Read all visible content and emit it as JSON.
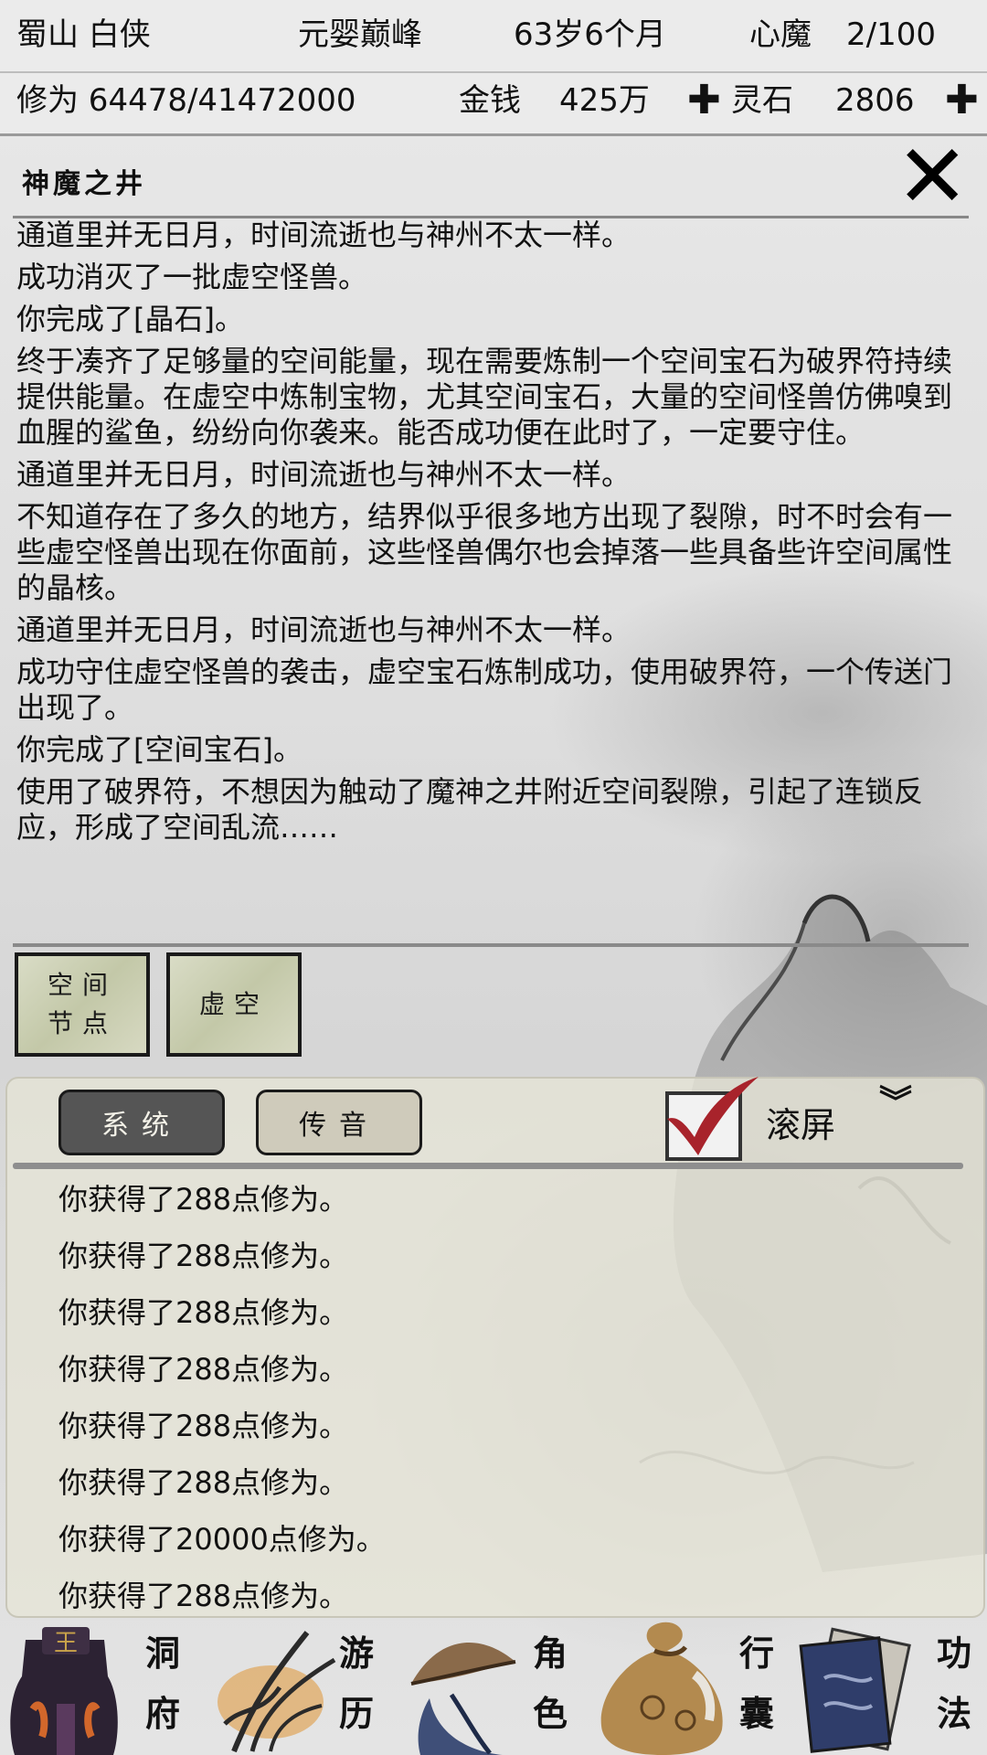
{
  "status": {
    "sect_rank": "蜀山 白侠",
    "realm": "元婴巅峰",
    "age": "63岁6个月",
    "demon_label": "心魔",
    "demon_value": "2/100",
    "cultivation": "修为 64478/41472000",
    "money_label": "金钱",
    "money_value": "425万",
    "stone_label": "灵石",
    "stone_value": "2806"
  },
  "panel": {
    "title": "神魔之井",
    "story": [
      "通道里并无日月，时间流逝也与神州不太一样。",
      "成功消灭了一批虚空怪兽。",
      "你完成了[晶石]。",
      "终于凑齐了足够量的空间能量，现在需要炼制一个空间宝石为破界符持续提供能量。在虚空中炼制宝物，尤其空间宝石，大量的空间怪兽仿佛嗅到血腥的鲨鱼，纷纷向你袭来。能否成功便在此时了，一定要守住。",
      "通道里并无日月，时间流逝也与神州不太一样。",
      "不知道存在了多久的地方，结界似乎很多地方出现了裂隙，时不时会有一些虚空怪兽出现在你面前，这些怪兽偶尔也会掉落一些具备些许空间属性的晶核。",
      "通道里并无日月，时间流逝也与神州不太一样。",
      "成功守住虚空怪兽的袭击，虚空宝石炼制成功，使用破界符，一个传送门出现了。",
      "你完成了[空间宝石]。",
      "使用了破界符，不想因为触动了魔神之井附近空间裂隙，引起了连锁反应，形成了空间乱流……"
    ],
    "locations": [
      {
        "line1": "空间",
        "line2": "节点"
      },
      {
        "line1": "虚空",
        "line2": ""
      }
    ]
  },
  "messages": {
    "tab_system": "系统",
    "tab_voice": "传音",
    "scroll_label": "滚屏",
    "scroll_checked": true,
    "items": [
      "你获得了288点修为。",
      "你获得了288点修为。",
      "你获得了288点修为。",
      "你获得了288点修为。",
      "你获得了288点修为。",
      "你获得了288点修为。",
      "你获得了20000点修为。",
      "你获得了288点修为。"
    ]
  },
  "nav": [
    {
      "c1": "洞",
      "c2": "府",
      "icon": "cave-icon"
    },
    {
      "c1": "游",
      "c2": "历",
      "icon": "travel-icon"
    },
    {
      "c1": "角",
      "c2": "色",
      "icon": "character-icon"
    },
    {
      "c1": "行",
      "c2": "囊",
      "icon": "bag-icon"
    },
    {
      "c1": "功",
      "c2": "法",
      "icon": "skill-book-icon"
    }
  ],
  "colors": {
    "checkmark": "#a8232b",
    "tab_active": "#555555",
    "tab_inactive": "#cfcbbb"
  }
}
